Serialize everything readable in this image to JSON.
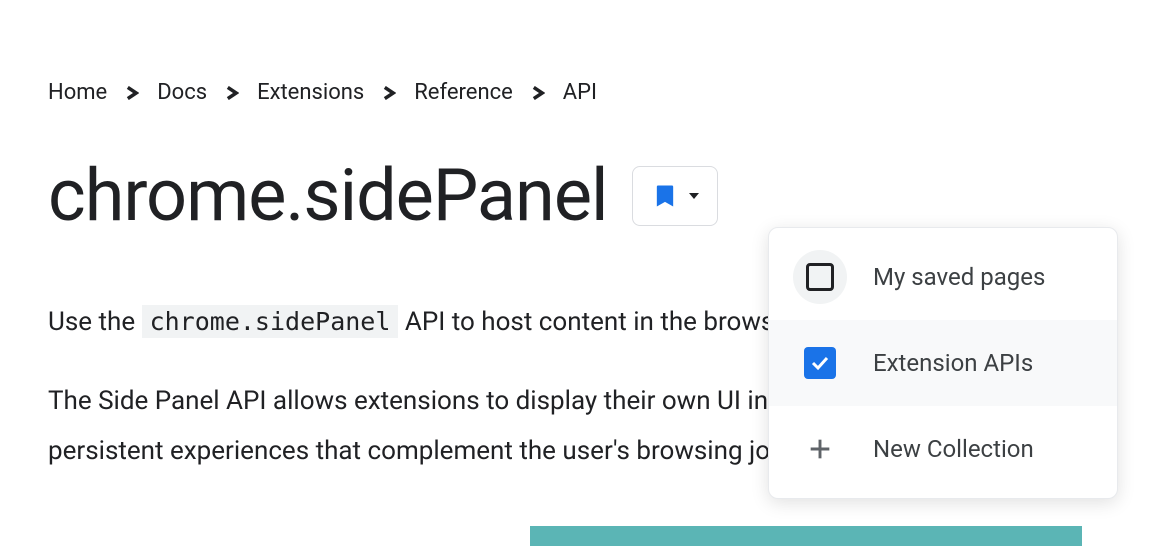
{
  "breadcrumbs": {
    "items": [
      "Home",
      "Docs",
      "Extensions",
      "Reference",
      "API"
    ]
  },
  "title": "chrome.sidePanel",
  "content": {
    "para1_pre": "Use the ",
    "para1_code": "chrome.sidePanel",
    "para1_post": " API to host content in the browser's side panel alongside the",
    "para2": "The Side Panel API allows extensions to display their own UI in the side panel, enabling persistent experiences that complement the user's browsing journey."
  },
  "dropdown": {
    "item1": "My saved pages",
    "item2": "Extension APIs",
    "item3": "New Collection"
  }
}
